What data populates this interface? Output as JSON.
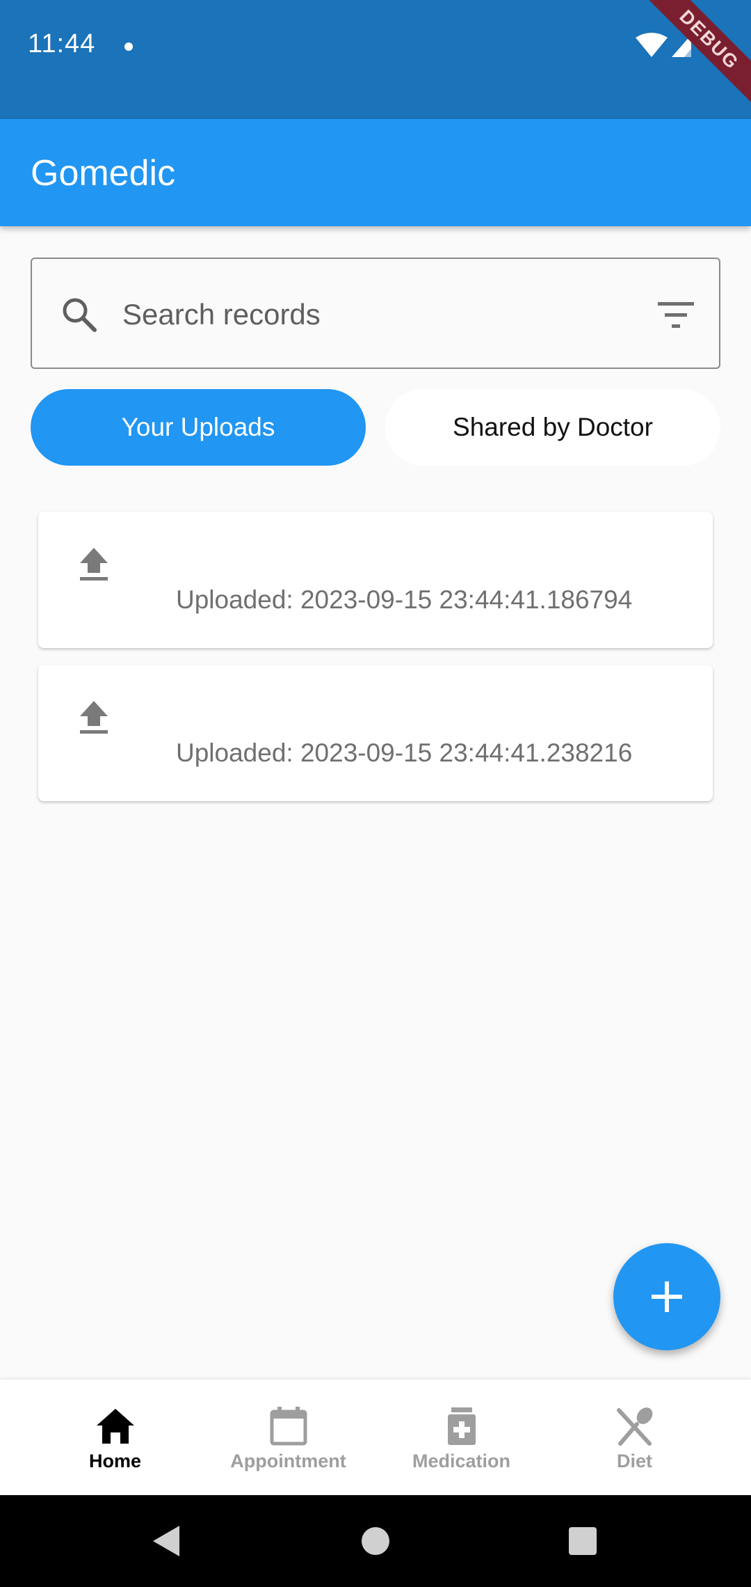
{
  "status_bar": {
    "time": "11:44",
    "debug_label": "DEBUG"
  },
  "app_bar": {
    "title": "Gomedic"
  },
  "search": {
    "placeholder": "Search records"
  },
  "toggle": {
    "your_uploads": "Your Uploads",
    "shared_by_doctor": "Shared by Doctor",
    "selected": "Your Uploads"
  },
  "records": [
    {
      "text": "Uploaded: 2023-09-15 23:44:41.186794",
      "icon": "upload-icon"
    },
    {
      "text": "Uploaded: 2023-09-15 23:44:41.238216",
      "icon": "upload-icon"
    }
  ],
  "fab": {
    "icon": "add-icon"
  },
  "bottom_nav": {
    "items": [
      {
        "label": "Home",
        "icon": "home-icon",
        "active": true
      },
      {
        "label": "Appointment",
        "icon": "calendar-icon",
        "active": false
      },
      {
        "label": "Medication",
        "icon": "medication-icon",
        "active": false
      },
      {
        "label": "Diet",
        "icon": "diet-icon",
        "active": false
      }
    ]
  },
  "colors": {
    "status_bar": "#1b73b9",
    "primary": "#2196f3",
    "background": "#fafafa",
    "debug_ribbon": "#7a1f2f",
    "nav_inactive": "#9e9e9e",
    "nav_active": "#000000"
  }
}
